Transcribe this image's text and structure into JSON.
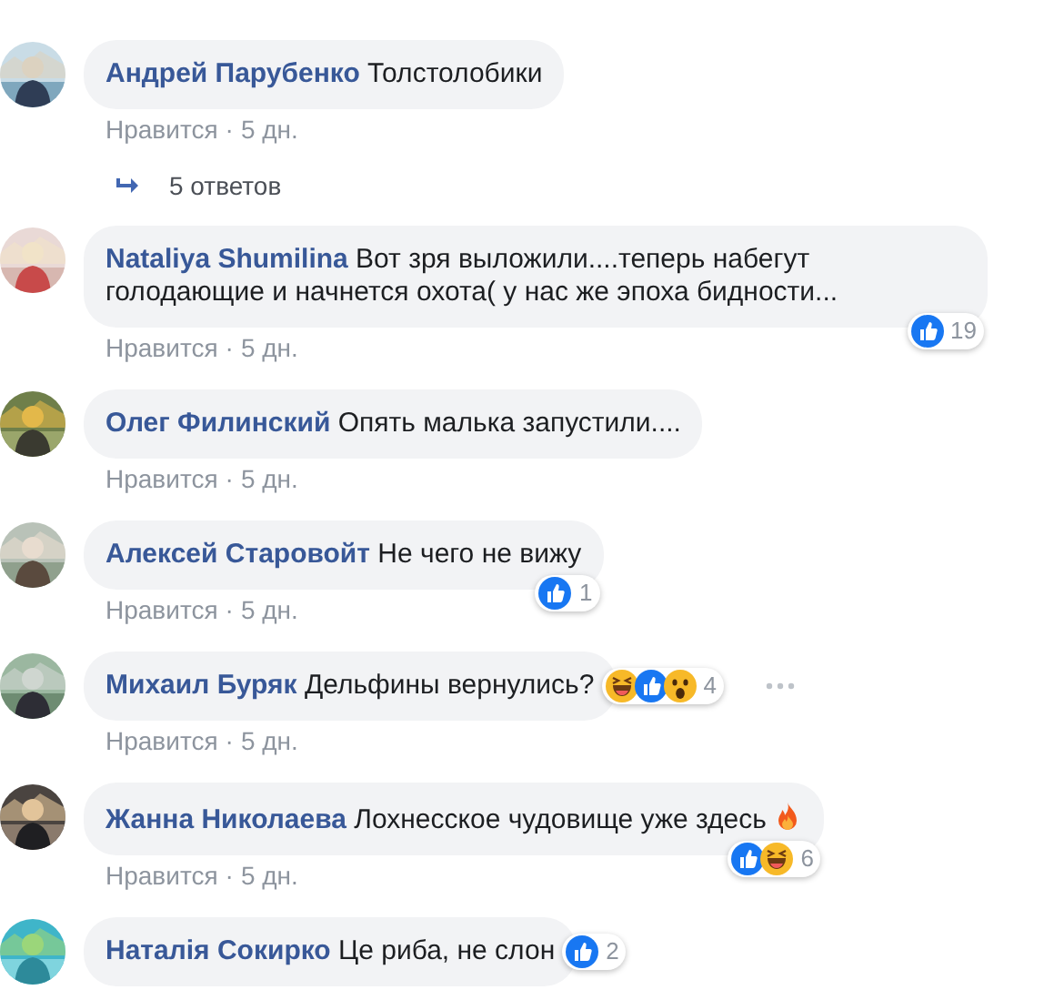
{
  "comments": [
    {
      "author": "Андрей Парубенко",
      "text": "Толстолобики",
      "like_label": "Нравится",
      "separator": "·",
      "time": "5 дн."
    },
    {
      "kind": "replies",
      "label": "5 ответов"
    },
    {
      "author": "Nataliya Shumilina",
      "text": "Вот зря выложили....теперь набегут голодающие и начнется охота( у нас же эпоха бидности...",
      "like_label": "Нравится",
      "separator": "·",
      "time": "5 дн.",
      "reactions": [
        {
          "kind": "like"
        }
      ],
      "count": "19",
      "inline": false
    },
    {
      "author": "Олег Филинский",
      "text": "Опять малька запустили....",
      "like_label": "Нравится",
      "separator": "·",
      "time": "5 дн."
    },
    {
      "author": "Алексей Старовойт",
      "text": "Не чего не вижу",
      "like_label": "Нравится",
      "separator": "·",
      "time": "5 дн.",
      "reactions": [
        {
          "kind": "like"
        }
      ],
      "count": "1",
      "inline": false
    },
    {
      "author": "Михаил Буряк",
      "text": "Дельфины вернулись?",
      "like_label": "Нравится",
      "separator": "·",
      "time": "5 дн.",
      "reactions": [
        {
          "kind": "haha"
        },
        {
          "kind": "like"
        },
        {
          "kind": "wow"
        }
      ],
      "count": "4",
      "inline": true,
      "more": true
    },
    {
      "author": "Жанна Николаева",
      "text": "Лохнесское чудовище уже здесь",
      "trailing_icon": {
        "kind": "fire"
      },
      "like_label": "Нравится",
      "separator": "·",
      "time": "5 дн.",
      "reactions": [
        {
          "kind": "like"
        },
        {
          "kind": "haha"
        }
      ],
      "count": "6",
      "inline": false
    },
    {
      "author": "Наталія Сокирко",
      "text": "Це риба, не слон",
      "reactions": [
        {
          "kind": "like"
        }
      ],
      "count": "2",
      "inline": true
    }
  ]
}
